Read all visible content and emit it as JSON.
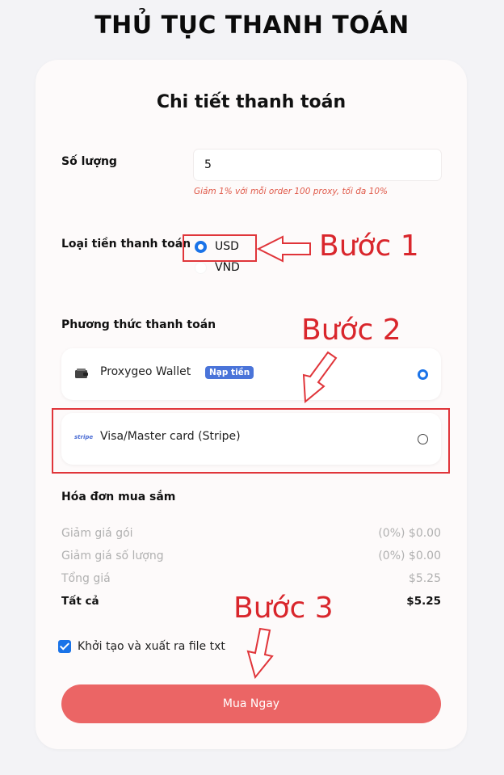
{
  "page": {
    "title": "THỦ TỤC THANH TOÁN"
  },
  "card": {
    "title": "Chi tiết thanh toán",
    "quantity": {
      "label": "Số lượng",
      "value": "5",
      "hint": "Giảm 1% với mỗi order 100 proxy, tối đa 10%"
    },
    "currency": {
      "label": "Loại tiền thanh toán",
      "options": [
        {
          "label": "USD",
          "selected": true
        },
        {
          "label": "VND",
          "selected": false
        }
      ]
    },
    "payment": {
      "label": "Phương thức thanh toán",
      "methods": [
        {
          "name": "Proxygeo Wallet",
          "badge": "Nạp tiền",
          "selected": true,
          "icon": "wallet-icon"
        },
        {
          "name": "Visa/Master card (Stripe)",
          "logo": "stripe",
          "selected": false,
          "icon": "stripe-logo"
        }
      ]
    },
    "invoice": {
      "title": "Hóa đơn mua sắm",
      "rows": [
        {
          "label": "Giảm giá gói",
          "value": "(0%) $0.00"
        },
        {
          "label": "Giảm giá số lượng",
          "value": "(0%) $0.00"
        },
        {
          "label": "Tổng giá",
          "value": "$5.25"
        }
      ],
      "total": {
        "label": "Tất cả",
        "value": "$5.25"
      }
    },
    "export_txt": {
      "label": "Khởi tạo và xuất ra file txt",
      "checked": true
    },
    "buy_button": "Mua Ngay"
  },
  "annotations": {
    "step1": "Bước 1",
    "step2": "Bước 2",
    "step3": "Bước 3",
    "color": "#d9262c"
  },
  "colors": {
    "accent": "#1a73e8",
    "button": "#eb6565",
    "badge": "#4a74d9"
  }
}
